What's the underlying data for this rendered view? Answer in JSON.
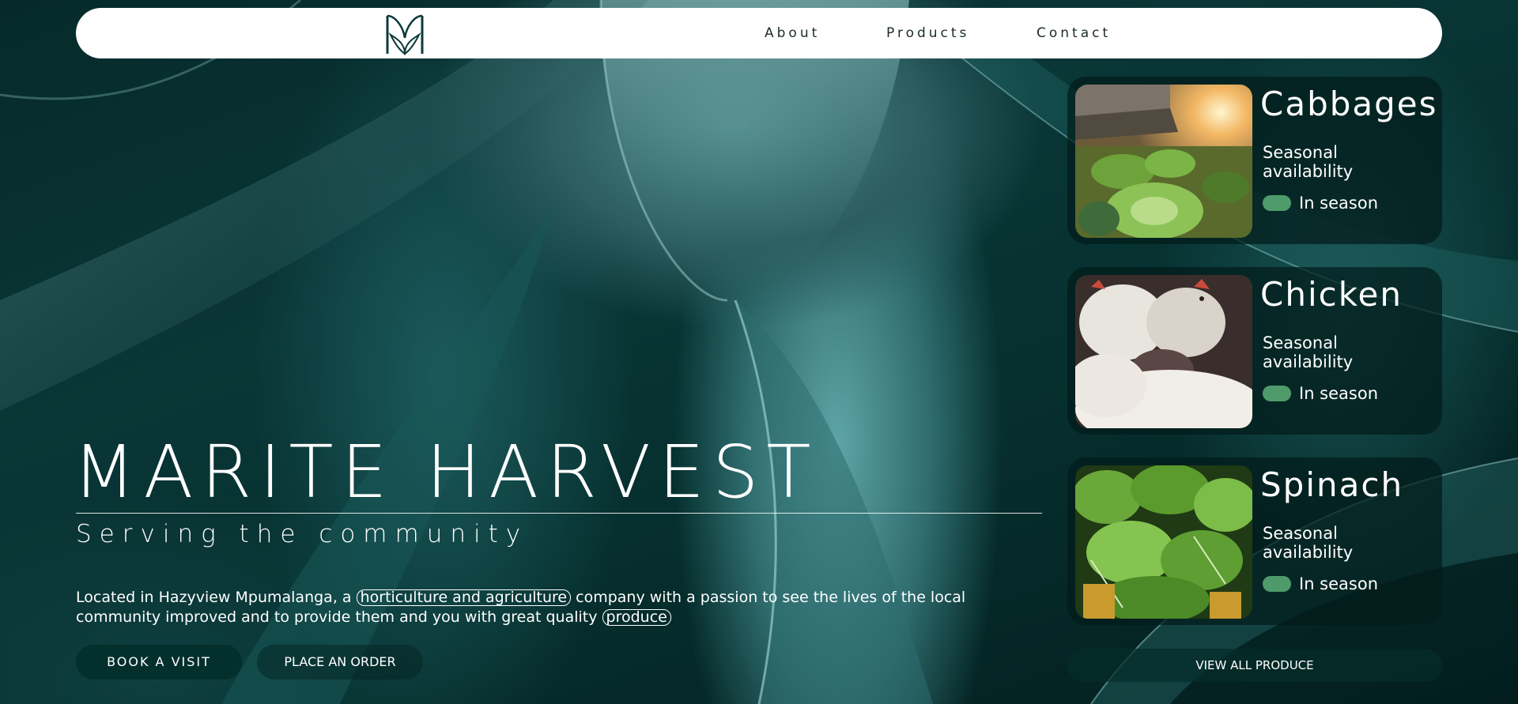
{
  "brand": {
    "logo": "leaf-monogram-logo"
  },
  "nav": {
    "links": [
      {
        "label": "About"
      },
      {
        "label": "Products"
      },
      {
        "label": "Contact"
      }
    ]
  },
  "hero": {
    "title": "MARITE HARVEST",
    "subtitle": "Serving the community",
    "description_parts": {
      "before": "Located in Hazyview Mpumalanga, a ",
      "highlight1": "horticulture and agriculture",
      "middle": " company with a passion to see the lives of the local community improved and to provide them and you with great quality ",
      "highlight2": "produce"
    },
    "primary_button": "BOOK A VISIT",
    "secondary_button": "PLACE AN ORDER"
  },
  "products": [
    {
      "name": "Cabbages",
      "label": "Seasonal availability",
      "status": "In season",
      "image": "cabbage-field-photo"
    },
    {
      "name": "Chicken",
      "label": "Seasonal availability",
      "status": "In season",
      "image": "chickens-photo"
    },
    {
      "name": "Spinach",
      "label": "Seasonal availability",
      "status": "In season",
      "image": "spinach-photo"
    }
  ],
  "view_all": "VIEW ALL PRODUCE",
  "colors": {
    "nav_bg": "#ffffff",
    "accent_green": "#4f9a6a",
    "button_dark": "#03302d"
  }
}
